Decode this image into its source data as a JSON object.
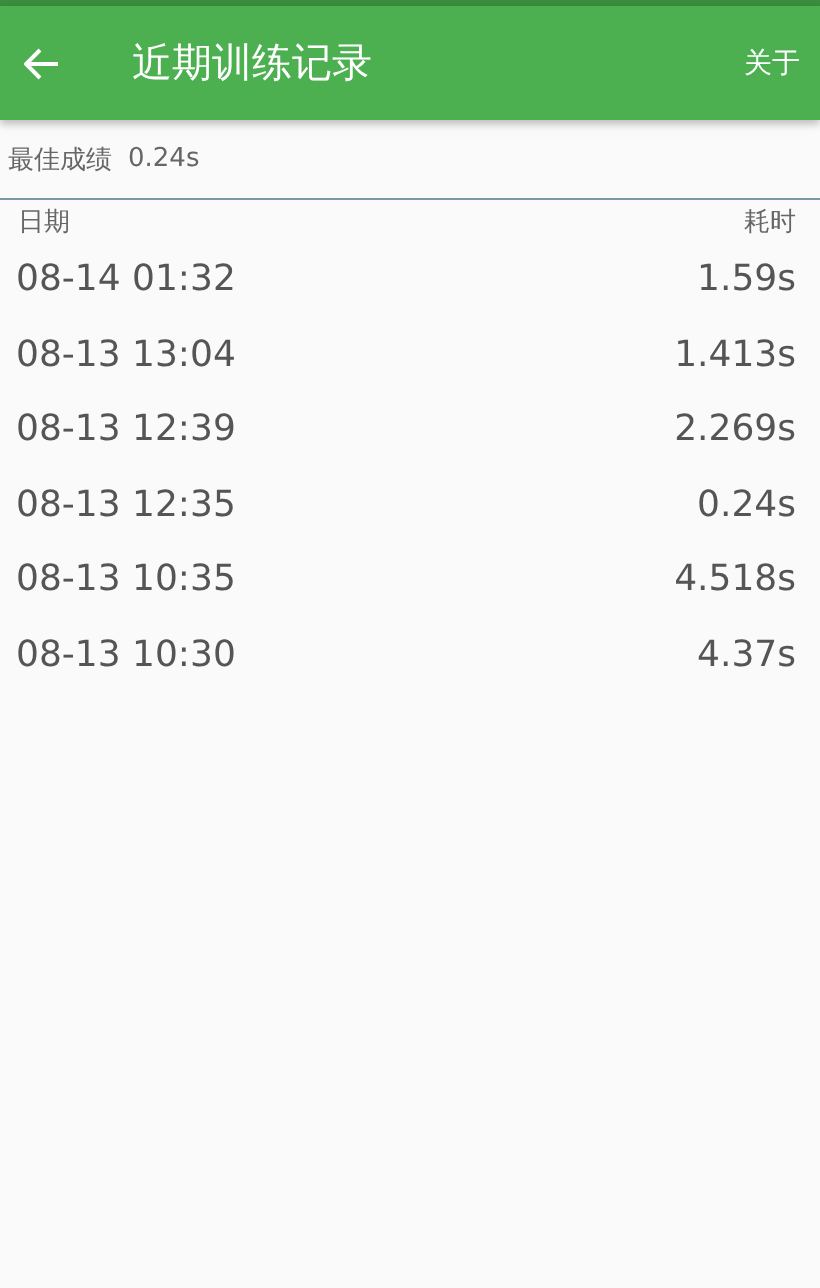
{
  "toolbar": {
    "title": "近期训练记录",
    "action": "关于"
  },
  "best": {
    "label": "最佳成绩",
    "value": "0.24s"
  },
  "table": {
    "columns": [
      "日期",
      "耗时"
    ],
    "rows": [
      {
        "date": "08-14 01:32",
        "time": "1.59s"
      },
      {
        "date": "08-13 13:04",
        "time": "1.413s"
      },
      {
        "date": "08-13 12:39",
        "time": "2.269s"
      },
      {
        "date": "08-13 12:35",
        "time": "0.24s"
      },
      {
        "date": "08-13 10:35",
        "time": "4.518s"
      },
      {
        "date": "08-13 10:30",
        "time": "4.37s"
      }
    ]
  }
}
